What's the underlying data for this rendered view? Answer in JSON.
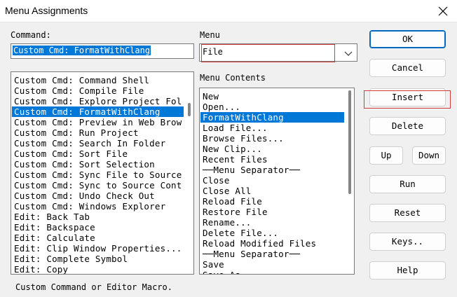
{
  "window": {
    "title": "Menu Assignments"
  },
  "labels": {
    "command": "Command:",
    "menu": "Menu",
    "menu_contents": "Menu Contents"
  },
  "command_field": {
    "value": "Custom Cmd: FormatWithClang"
  },
  "menu_combo": {
    "value": "File"
  },
  "commands": [
    {
      "label": "Custom Cmd: Command Shell",
      "selected": false
    },
    {
      "label": "Custom Cmd: Compile File",
      "selected": false
    },
    {
      "label": "Custom Cmd: Explore Project Fol",
      "selected": false
    },
    {
      "label": "Custom Cmd: FormatWithClang",
      "selected": true
    },
    {
      "label": "Custom Cmd: Preview in Web Brow",
      "selected": false
    },
    {
      "label": "Custom Cmd: Run Project",
      "selected": false
    },
    {
      "label": "Custom Cmd: Search In Folder",
      "selected": false
    },
    {
      "label": "Custom Cmd: Sort File",
      "selected": false
    },
    {
      "label": "Custom Cmd: Sort Selection",
      "selected": false
    },
    {
      "label": "Custom Cmd: Sync File to Source",
      "selected": false
    },
    {
      "label": "Custom Cmd: Sync to Source Cont",
      "selected": false
    },
    {
      "label": "Custom Cmd: Undo Check Out",
      "selected": false
    },
    {
      "label": "Custom Cmd: Windows Explorer",
      "selected": false
    },
    {
      "label": "Edit: Back Tab",
      "selected": false
    },
    {
      "label": "Edit: Backspace",
      "selected": false
    },
    {
      "label": "Edit: Calculate",
      "selected": false
    },
    {
      "label": "Edit: Clip Window Properties...",
      "selected": false
    },
    {
      "label": "Edit: Complete Symbol",
      "selected": false
    },
    {
      "label": "Edit: Copy",
      "selected": false
    }
  ],
  "menu_contents": [
    {
      "label": "New",
      "selected": false
    },
    {
      "label": "Open...",
      "selected": false
    },
    {
      "label": "FormatWithClang",
      "selected": true
    },
    {
      "label": "Load File...",
      "selected": false
    },
    {
      "label": "Browse Files...",
      "selected": false
    },
    {
      "label": "New Clip...",
      "selected": false
    },
    {
      "label": "Recent Files",
      "selected": false
    },
    {
      "label": "──Menu Separator──",
      "selected": false
    },
    {
      "label": "Close",
      "selected": false
    },
    {
      "label": "Close All",
      "selected": false
    },
    {
      "label": "Reload File",
      "selected": false
    },
    {
      "label": "Restore File",
      "selected": false
    },
    {
      "label": "Rename...",
      "selected": false
    },
    {
      "label": "Delete File...",
      "selected": false
    },
    {
      "label": "Reload Modified Files",
      "selected": false
    },
    {
      "label": "──Menu Separator──",
      "selected": false
    },
    {
      "label": "Save",
      "selected": false
    },
    {
      "label": "Save As...",
      "selected": false
    }
  ],
  "buttons": {
    "ok": "OK",
    "cancel": "Cancel",
    "insert": "Insert",
    "delete": "Delete",
    "up": "Up",
    "down": "Down",
    "run": "Run",
    "reset": "Reset",
    "keys": "Keys..",
    "help": "Help"
  },
  "status": "Custom Command or Editor Macro.",
  "colors": {
    "selection": "#0078d7",
    "highlight": "#d23c3c",
    "default_button": "#0067c0"
  }
}
